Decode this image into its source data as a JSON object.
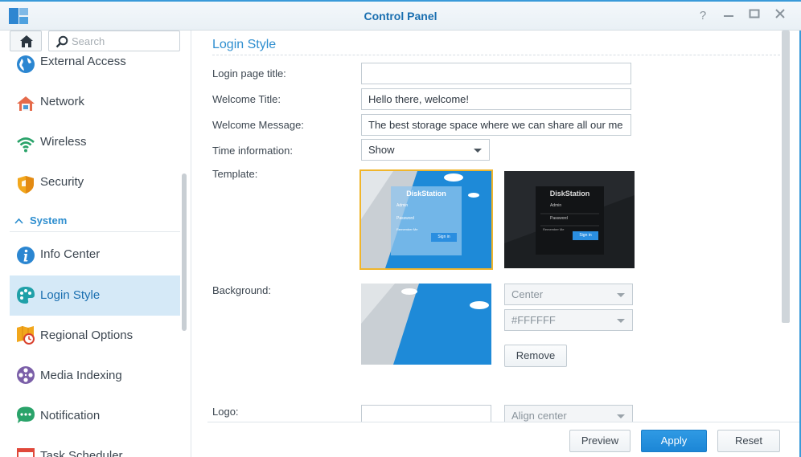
{
  "window": {
    "title": "Control Panel"
  },
  "sidebar": {
    "search_placeholder": "Search",
    "items": [
      {
        "label": "External Access"
      },
      {
        "label": "Network"
      },
      {
        "label": "Wireless"
      },
      {
        "label": "Security"
      }
    ],
    "section": {
      "label": "System"
    },
    "system_items": [
      {
        "label": "Info Center"
      },
      {
        "label": "Login Style",
        "active": true
      },
      {
        "label": "Regional Options"
      },
      {
        "label": "Media Indexing"
      },
      {
        "label": "Notification"
      },
      {
        "label": "Task Scheduler"
      }
    ]
  },
  "main": {
    "title": "Login Style",
    "fields": {
      "login_page_title": {
        "label": "Login page title:",
        "value": ""
      },
      "welcome_title": {
        "label": "Welcome Title:",
        "value": "Hello there, welcome!"
      },
      "welcome_message": {
        "label": "Welcome Message:",
        "value": "The best storage space where we can share all our me"
      },
      "time_information": {
        "label": "Time information:",
        "value": "Show"
      },
      "template": {
        "label": "Template:"
      },
      "background": {
        "label": "Background:",
        "position": "Center",
        "color": "#FFFFFF",
        "remove_label": "Remove"
      },
      "logo": {
        "label": "Logo:",
        "alignment": "Align center"
      }
    },
    "template_preview": {
      "brand": "DiskStation",
      "user": "Admin",
      "password": "Password",
      "remember": "Remember Me",
      "signin": "Sign in"
    }
  },
  "footer": {
    "preview": "Preview",
    "apply": "Apply",
    "reset": "Reset"
  },
  "colors": {
    "accent": "#2e8ecf",
    "active_bg": "#d5e9f7",
    "selected_outline": "#f0b52b",
    "primary_button": "#1c86d6"
  }
}
